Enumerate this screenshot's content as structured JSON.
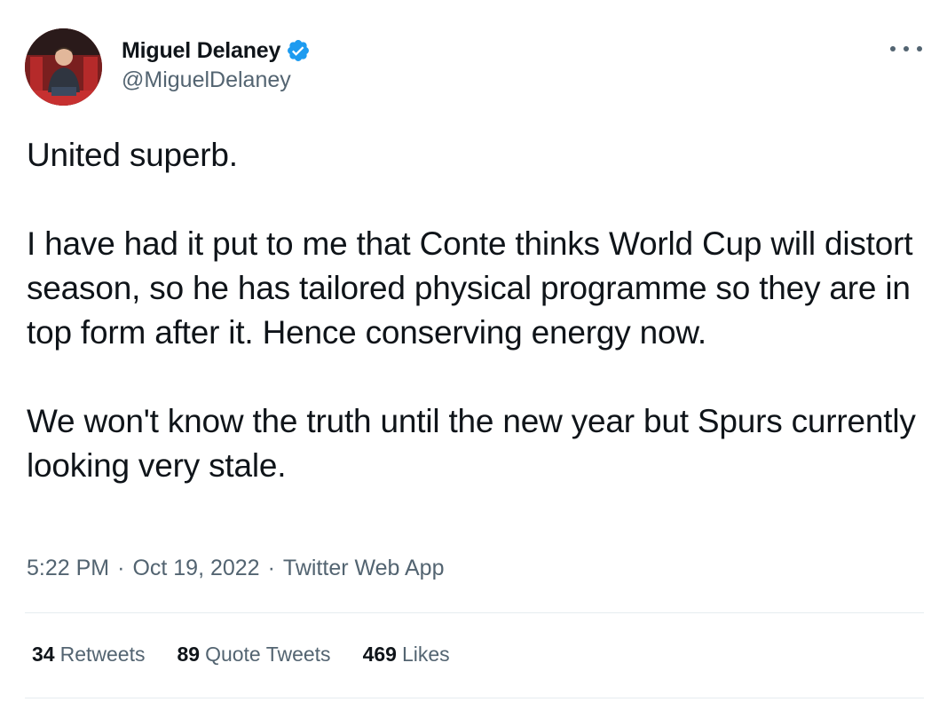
{
  "author": {
    "display_name": "Miguel Delaney",
    "handle": "@MiguelDelaney",
    "verified": true
  },
  "tweet": {
    "paragraphs": [
      "United superb.",
      "I have had it put to me that Conte thinks World Cup will distort season, so he has tailored physical programme so they are in top form after it. Hence conserving energy now.",
      "We won't know the truth until the new year but Spurs currently looking very stale."
    ],
    "time": "5:22 PM",
    "date": "Oct 19, 2022",
    "source": "Twitter Web App",
    "separator": "·"
  },
  "stats": {
    "retweets_count": "34",
    "retweets_label": "Retweets",
    "quotes_count": "89",
    "quotes_label": "Quote Tweets",
    "likes_count": "469",
    "likes_label": "Likes"
  },
  "icons": {
    "verified": "verified-badge-icon",
    "more": "more-horizontal-icon"
  },
  "colors": {
    "text_primary": "#0f1419",
    "text_secondary": "#536471",
    "verified_blue": "#1d9bf0",
    "divider": "#e6ecf0"
  }
}
